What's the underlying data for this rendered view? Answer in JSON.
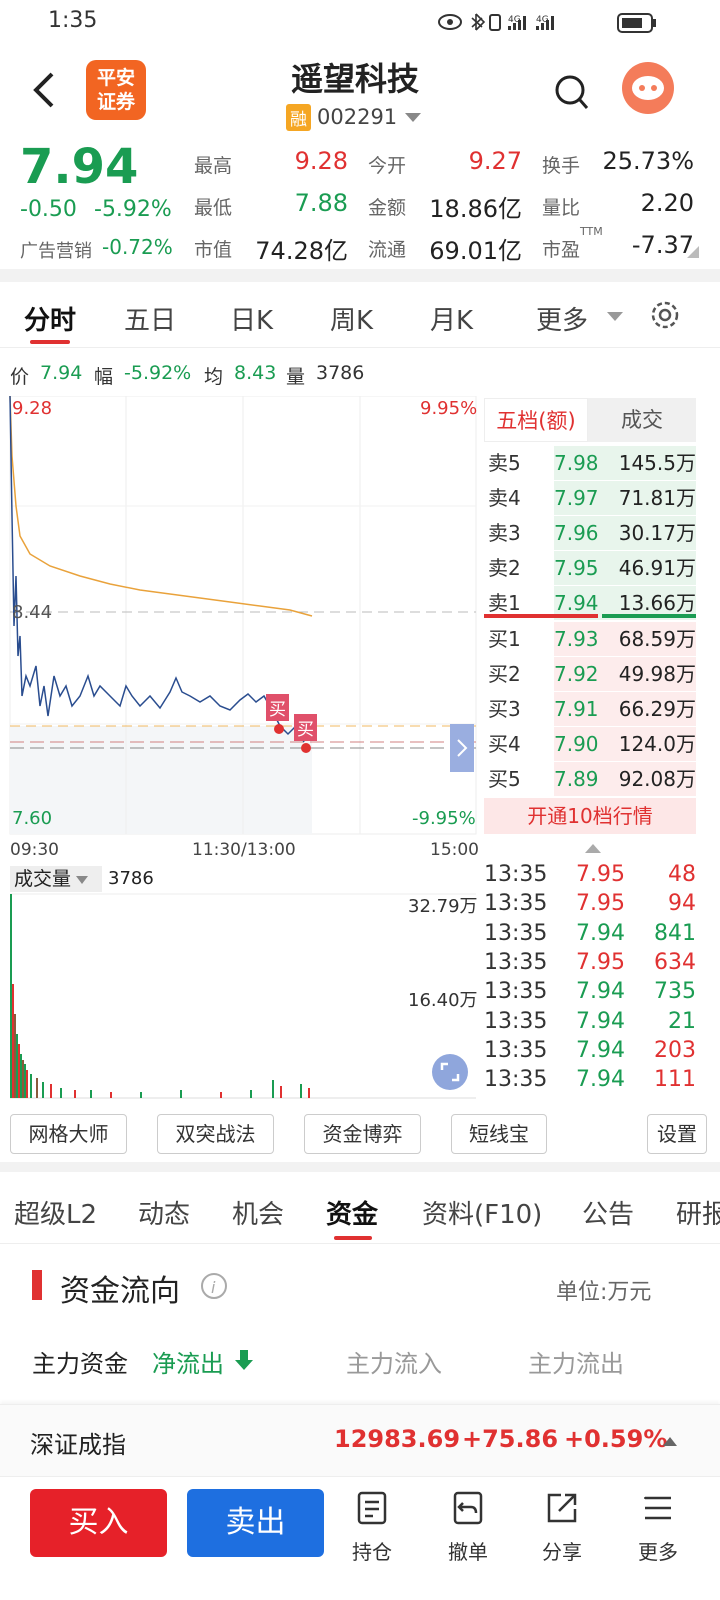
{
  "status": {
    "time": "1:35",
    "net1": "4G",
    "net2": "4G"
  },
  "header": {
    "title": "遥望科技",
    "margin_badge": "融",
    "code": "002291",
    "logo_line1": "平安",
    "logo_line2": "证券"
  },
  "quote": {
    "price": "7.94",
    "change": "-0.50",
    "change_pct": "-5.92%",
    "sector_label": "广告营销",
    "sector_pct": "-0.72%",
    "stats": [
      {
        "label": "最高",
        "value": "9.28",
        "color": "red"
      },
      {
        "label": "今开",
        "value": "9.27",
        "color": "red"
      },
      {
        "label": "换手",
        "value": "25.73%",
        "color": "dark"
      },
      {
        "label": "最低",
        "value": "7.88",
        "color": "green"
      },
      {
        "label": "金额",
        "value": "18.86亿",
        "color": "dark"
      },
      {
        "label": "量比",
        "value": "2.20",
        "color": "dark"
      },
      {
        "label": "市值",
        "value": "74.28亿",
        "color": "dark"
      },
      {
        "label": "流通",
        "value": "69.01亿",
        "color": "dark"
      },
      {
        "label": "市盈",
        "value": "-7.37",
        "color": "dark"
      }
    ],
    "pe_sup": "TTM"
  },
  "tabs": {
    "items": [
      "分时",
      "五日",
      "日K",
      "周K",
      "月K",
      "更多"
    ]
  },
  "infoline": {
    "price_label": "价",
    "price": "7.94",
    "amp_label": "幅",
    "amp": "-5.92%",
    "avg_label": "均",
    "avg": "8.43",
    "vol_label": "量",
    "vol": "3786"
  },
  "chart": {
    "top_price": "9.28",
    "top_pct": "9.95%",
    "mid_price": "8.44",
    "bottom_price": "7.60",
    "bottom_pct": "-9.95%",
    "buy_tag": "买",
    "time_start": "09:30",
    "time_mid": "11:30/13:00",
    "time_end": "15:00"
  },
  "volume": {
    "selector": "成交量",
    "value": "3786",
    "max_label": "32.79万",
    "mid_label": "16.40万"
  },
  "orderbook": {
    "tab1": "五档(额)",
    "tab2": "成交",
    "sells": [
      {
        "label": "卖5",
        "price": "7.98",
        "amount": "145.5万"
      },
      {
        "label": "卖4",
        "price": "7.97",
        "amount": "71.81万"
      },
      {
        "label": "卖3",
        "price": "7.96",
        "amount": "30.17万"
      },
      {
        "label": "卖2",
        "price": "7.95",
        "amount": "46.91万"
      },
      {
        "label": "卖1",
        "price": "7.94",
        "amount": "13.66万"
      }
    ],
    "buys": [
      {
        "label": "买1",
        "price": "7.93",
        "amount": "68.59万"
      },
      {
        "label": "买2",
        "price": "7.92",
        "amount": "49.98万"
      },
      {
        "label": "买3",
        "price": "7.91",
        "amount": "66.29万"
      },
      {
        "label": "买4",
        "price": "7.90",
        "amount": "124.0万"
      },
      {
        "label": "买5",
        "price": "7.89",
        "amount": "92.08万"
      }
    ],
    "upgrade": "开通10档行情"
  },
  "trades": [
    {
      "time": "13:35",
      "price": "7.95",
      "vol": "48",
      "vcolor": "red"
    },
    {
      "time": "13:35",
      "price": "7.95",
      "vol": "94",
      "vcolor": "red"
    },
    {
      "time": "13:35",
      "price": "7.94",
      "vol": "841",
      "vcolor": "green"
    },
    {
      "time": "13:35",
      "price": "7.95",
      "vol": "634",
      "vcolor": "red"
    },
    {
      "time": "13:35",
      "price": "7.94",
      "vol": "735",
      "vcolor": "green"
    },
    {
      "time": "13:35",
      "price": "7.94",
      "vol": "21",
      "vcolor": "green"
    },
    {
      "time": "13:35",
      "price": "7.94",
      "vol": "203",
      "vcolor": "red"
    },
    {
      "time": "13:35",
      "price": "7.94",
      "vol": "111",
      "vcolor": "red"
    }
  ],
  "tools": [
    "网格大师",
    "双突战法",
    "资金博弈",
    "短线宝",
    "设置"
  ],
  "subtabs": [
    "超级L2",
    "动态",
    "机会",
    "资金",
    "资料(F10)",
    "公告",
    "研报"
  ],
  "fund": {
    "title": "资金流向",
    "unit": "单位:万元",
    "main_label": "主力资金",
    "net": "净流出",
    "inflow_label": "主力流入",
    "outflow_label": "主力流出"
  },
  "index": {
    "name": "深证成指",
    "value": "12983.69",
    "change": "+75.86",
    "pct": "+0.59%"
  },
  "bottom": {
    "buy": "买入",
    "sell": "卖出",
    "hold": "持仓",
    "cancel": "撤单",
    "share": "分享",
    "more": "更多"
  },
  "colors": {
    "red": "#e03131",
    "green": "#1a9c52",
    "blue": "#1e6fe0",
    "avg_line": "#e9a23b",
    "price_line": "#2a4d8f"
  }
}
